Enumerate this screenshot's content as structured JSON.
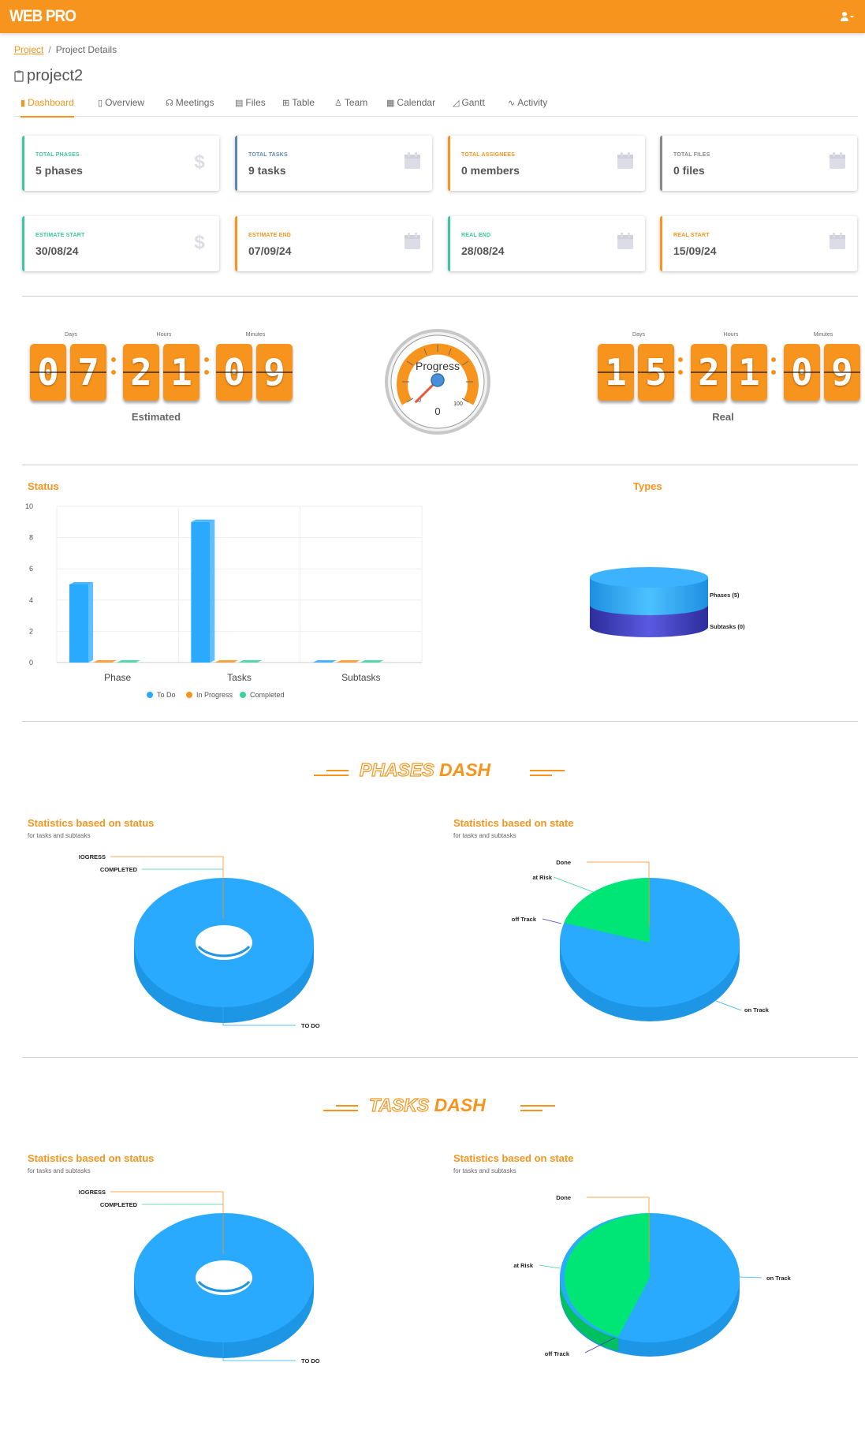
{
  "app": {
    "brand": "WEB PRO"
  },
  "breadcrumb": {
    "parent": "Project",
    "current": "Project Details"
  },
  "project": {
    "title": "project2"
  },
  "tabs": [
    {
      "label": "Dashboard",
      "icon": "bar-chart-icon",
      "active": true
    },
    {
      "label": "Overview",
      "icon": "clipboard-icon"
    },
    {
      "label": "Meetings",
      "icon": "headset-icon"
    },
    {
      "label": "Files",
      "icon": "file-icon"
    },
    {
      "label": "Table",
      "icon": "table-icon"
    },
    {
      "label": "Team",
      "icon": "user-icon"
    },
    {
      "label": "Calendar",
      "icon": "calendar-icon"
    },
    {
      "label": "Gantt",
      "icon": "area-chart-icon"
    },
    {
      "label": "Activity",
      "icon": "pulse-icon"
    }
  ],
  "cards": [
    {
      "label": "TOTAL PHASES",
      "value": "5 phases",
      "icon": "dollar-icon",
      "accent": "#3cc7a0"
    },
    {
      "label": "TOTAL TASKS",
      "value": "9 tasks",
      "icon": "calendar-icon",
      "accent": "#5b88b9"
    },
    {
      "label": "TOTAL ASSIGNEES",
      "value": "0 members",
      "icon": "calendar-icon",
      "accent": "#f7941d"
    },
    {
      "label": "TOTAL FILES",
      "value": "0 files",
      "icon": "calendar-icon",
      "accent": "#888888"
    },
    {
      "label": "ESTIMATE START",
      "value": "30/08/24",
      "icon": "dollar-icon",
      "accent": "#3cc7a0"
    },
    {
      "label": "ESTIMATE END",
      "value": "07/09/24",
      "icon": "calendar-icon",
      "accent": "#f7941d"
    },
    {
      "label": "REAL END",
      "value": "28/08/24",
      "icon": "calendar-icon",
      "accent": "#3cc7a0"
    },
    {
      "label": "REAL START",
      "value": "15/09/24",
      "icon": "calendar-icon",
      "accent": "#f7941d"
    }
  ],
  "countdowns": {
    "units": {
      "days": "Days",
      "hours": "Hours",
      "minutes": "Minutes"
    },
    "estimated": {
      "label": "Estimated",
      "days": "07",
      "hours": "21",
      "minutes": "09"
    },
    "real": {
      "label": "Real",
      "days": "15",
      "hours": "21",
      "minutes": "09"
    }
  },
  "gauge": {
    "title": "Progress",
    "value": "0",
    "min_label": "0",
    "max_label": "100",
    "progress": 0
  },
  "status_chart": {
    "title": "Status"
  },
  "types_chart": {
    "title": "Types"
  },
  "phases_dash": {
    "heading_outline": "PHASES",
    "heading_solid": "DASH",
    "status": {
      "title": "Statistics based on status",
      "subtitle": "for tasks and subtasks"
    },
    "state": {
      "title": "Statistics based on state",
      "subtitle": "for tasks and subtasks"
    }
  },
  "tasks_dash": {
    "heading_outline": "TASKS",
    "heading_solid": "DASH",
    "status": {
      "title": "Statistics based on status",
      "subtitle": "for tasks and subtasks"
    },
    "state": {
      "title": "Statistics based on state",
      "subtitle": "for tasks and subtasks"
    }
  },
  "colors": {
    "brand": "#f7941d",
    "todo": "#29aaff",
    "in_progress": "#f7941d",
    "completed": "#3ad29f",
    "green": "#00e676",
    "indigo": "#3f3fb8"
  },
  "chart_data": [
    {
      "type": "bar",
      "title": "Status",
      "categories": [
        "Phase",
        "Tasks",
        "Subtasks"
      ],
      "series": [
        {
          "name": "To Do",
          "values": [
            5,
            9,
            0
          ]
        },
        {
          "name": "In Progress",
          "values": [
            0,
            0,
            0
          ]
        },
        {
          "name": "Completed",
          "values": [
            0,
            0,
            0
          ]
        }
      ],
      "ylim": [
        0,
        10
      ],
      "yticks": [
        "0",
        "2",
        "4",
        "6",
        "8",
        "10"
      ],
      "legend": "bottom"
    },
    {
      "type": "pie",
      "title": "Types",
      "labels": [
        "Phases (5)",
        "Subtasks (0)"
      ],
      "values": [
        5,
        0
      ]
    },
    {
      "type": "pie",
      "title": "Statistics based on status",
      "labels": [
        "TO DO",
        "IN PROGRESS",
        "COMPLETED"
      ],
      "values": [
        100,
        0,
        0
      ]
    },
    {
      "type": "pie",
      "title": "Statistics based on state",
      "labels": [
        "on Track",
        "Done",
        "at Risk",
        "off Track"
      ],
      "values": [
        80,
        0,
        20,
        0
      ]
    },
    {
      "type": "pie",
      "title": "Statistics based on status",
      "labels": [
        "TO DO",
        "IN PROGRESS",
        "COMPLETED"
      ],
      "values": [
        100,
        0,
        0
      ]
    },
    {
      "type": "pie",
      "title": "Statistics based on state",
      "labels": [
        "on Track",
        "Done",
        "at Risk",
        "off Track"
      ],
      "values": [
        56,
        0,
        44,
        0
      ]
    }
  ]
}
